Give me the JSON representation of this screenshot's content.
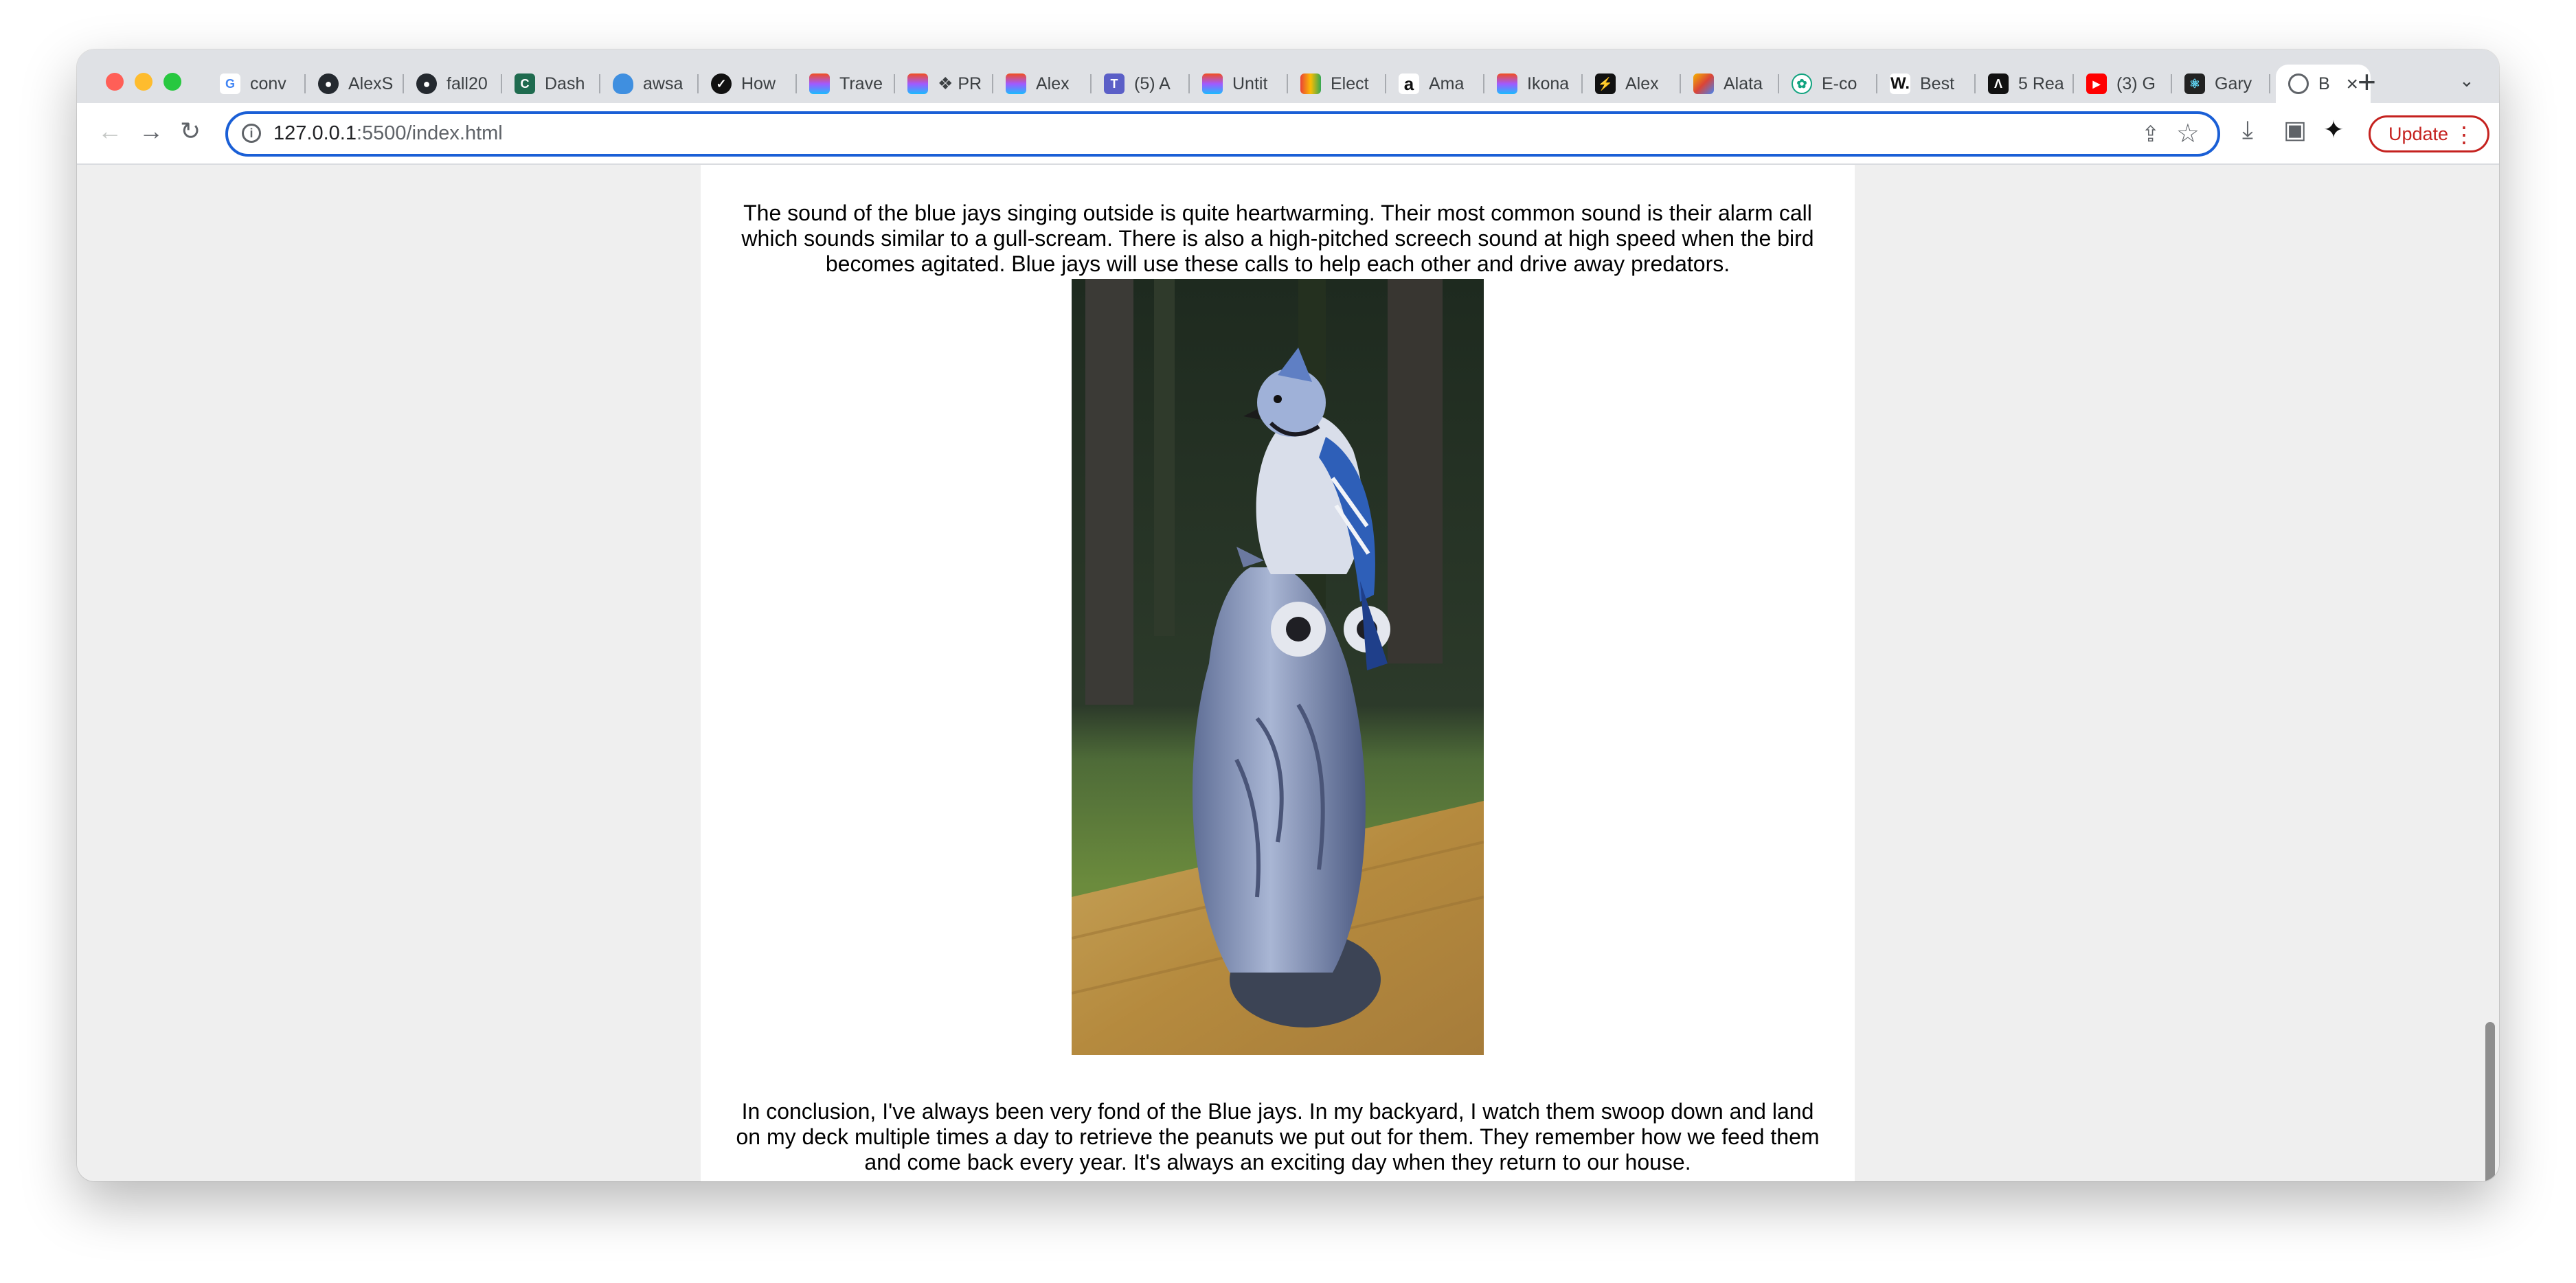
{
  "browser": {
    "tabs": [
      {
        "label": "conv",
        "icon": "google-icon"
      },
      {
        "label": "AlexS",
        "icon": "github-icon"
      },
      {
        "label": "fall20",
        "icon": "github-icon"
      },
      {
        "label": "Dash",
        "icon": "dash-icon"
      },
      {
        "label": "awsa",
        "icon": "cloud-icon"
      },
      {
        "label": "How",
        "icon": "how-icon"
      },
      {
        "label": "Trave",
        "icon": "figma-icon"
      },
      {
        "label": "❖ PR",
        "icon": "figma-icon"
      },
      {
        "label": "Alex",
        "icon": "figma-icon"
      },
      {
        "label": "(5) A",
        "icon": "teams-icon"
      },
      {
        "label": "Untit",
        "icon": "figma-icon"
      },
      {
        "label": "Elect",
        "icon": "elect-icon"
      },
      {
        "label": "Ama",
        "icon": "amazon-icon"
      },
      {
        "label": "Ikona",
        "icon": "figma-icon"
      },
      {
        "label": "Alex",
        "icon": "framer-icon"
      },
      {
        "label": "Alata",
        "icon": "alata-icon"
      },
      {
        "label": "E-co",
        "icon": "openai-icon"
      },
      {
        "label": "Best",
        "icon": "webflow-icon"
      },
      {
        "label": "5 Rea",
        "icon": "article-icon"
      },
      {
        "label": "(3) G",
        "icon": "youtube-icon"
      },
      {
        "label": "Gary",
        "icon": "react-icon"
      }
    ],
    "active_tab": {
      "label": "B",
      "icon": "globe-icon"
    },
    "url_host": "127.0.0.1",
    "url_rest": ":5500/index.html",
    "update_label": "Update"
  },
  "page": {
    "paragraph_top": "The sound of the blue jays singing outside is quite heartwarming. Their most common sound is their alarm call which sounds similar to a gull-scream. There is also a high-pitched screech sound at high speed when the bird becomes agitated. Blue jays will use these calls to help each other and drive away predators.",
    "paragraph_bottom": "In conclusion, I've always been very fond of the Blue jays. In my backyard, I watch them swoop down and land on my deck multiple times a day to retrieve the peanuts we put out for them. They remember how we feed them and come back every year. It's always an exciting day when they return to our house."
  }
}
